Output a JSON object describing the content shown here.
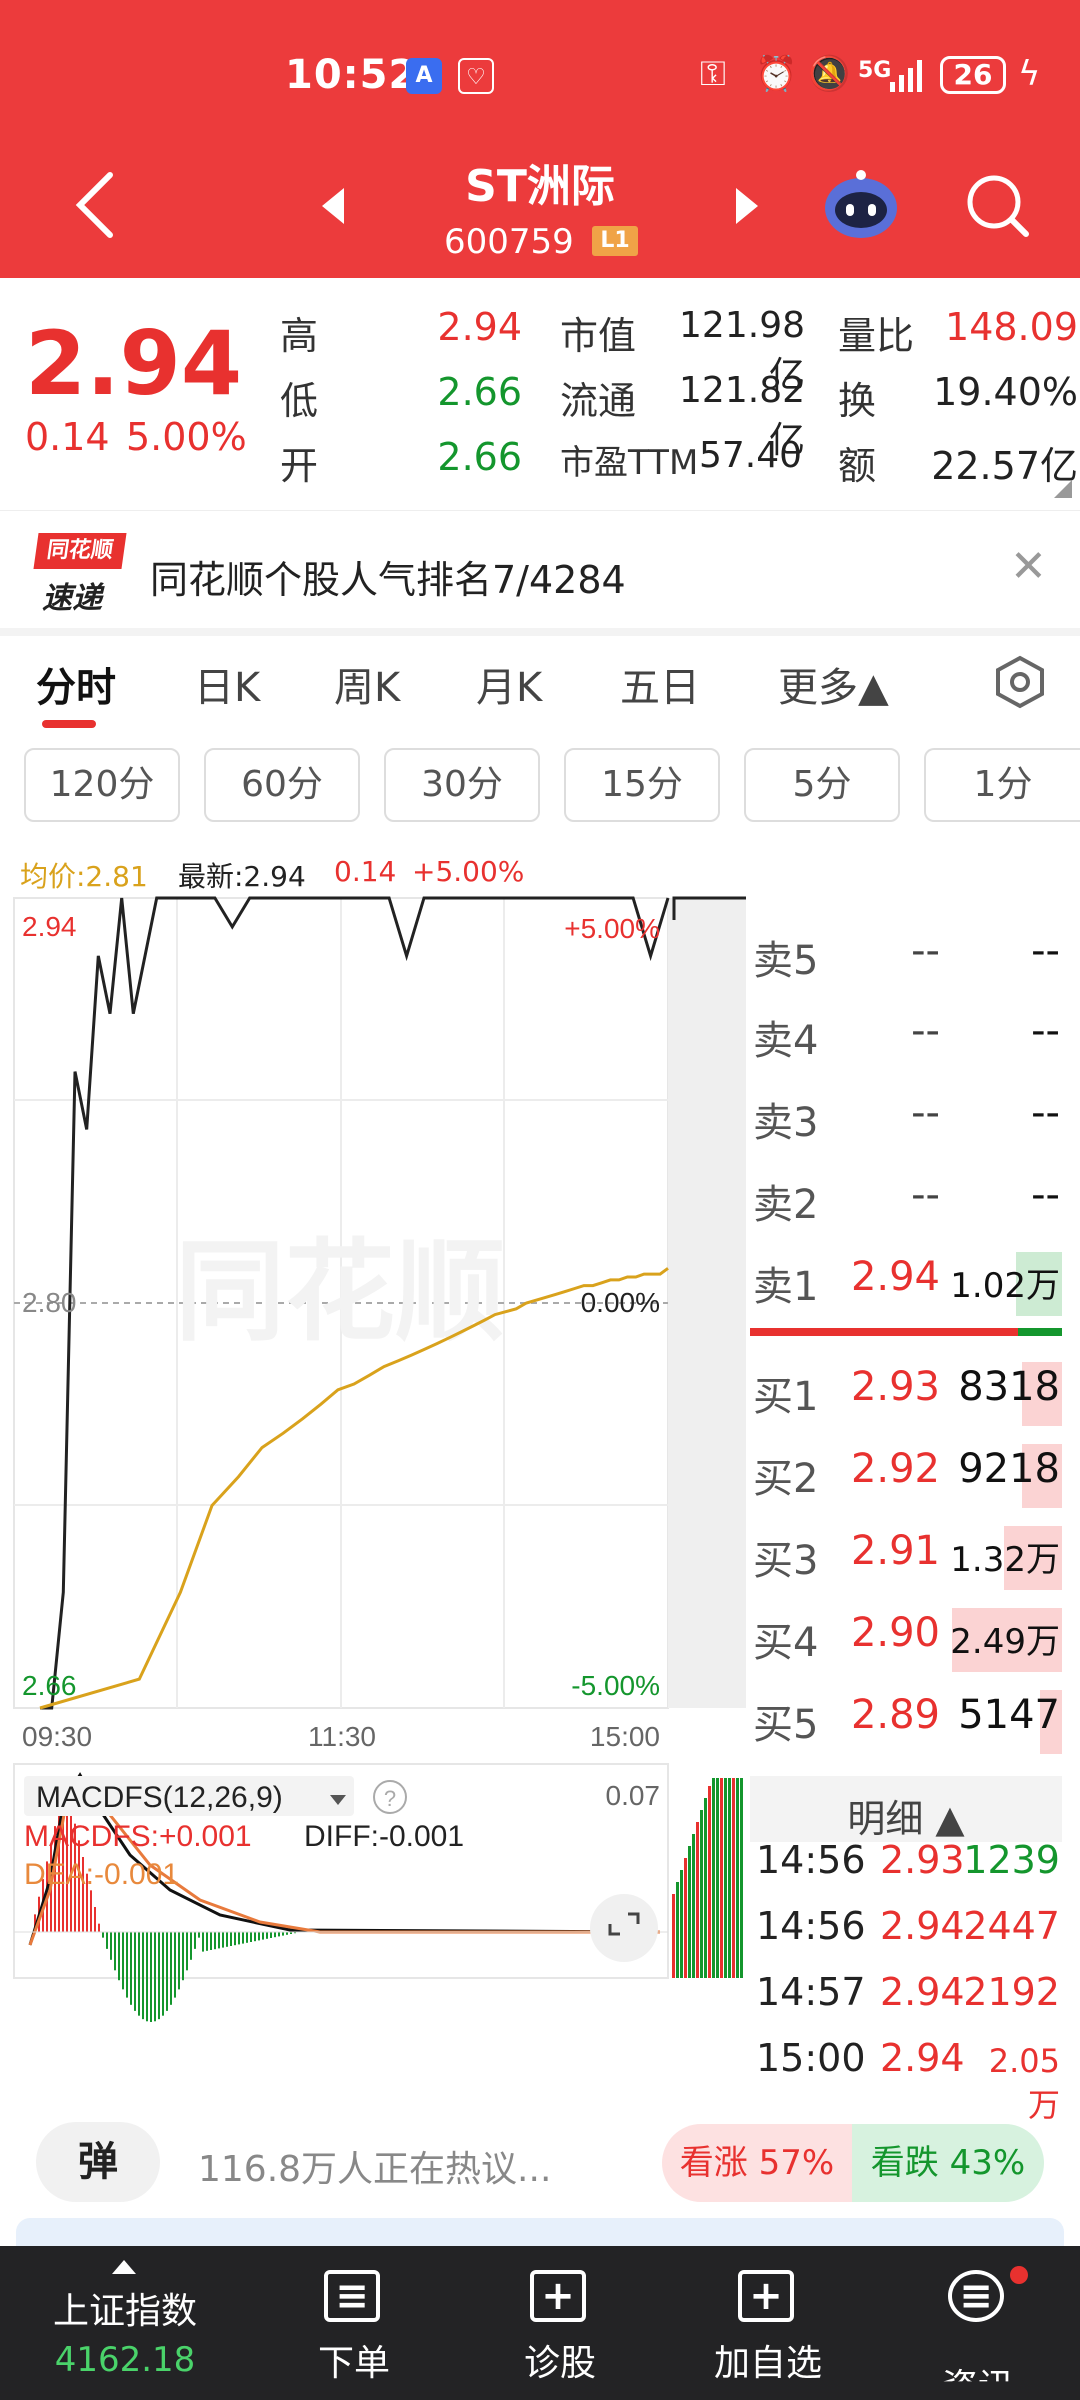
{
  "status_bar": {
    "time": "10:52",
    "network": "5G",
    "battery": "26"
  },
  "header": {
    "title": "ST洲际",
    "code": "600759",
    "level_badge": "L1"
  },
  "quote": {
    "price": "2.94",
    "change": "0.14",
    "change_pct": "5.00%",
    "stats": [
      {
        "label": "高",
        "value": "2.94"
      },
      {
        "label": "低",
        "value": "2.66"
      },
      {
        "label": "开",
        "value": "2.66"
      },
      {
        "label": "市值",
        "value": "121.98亿"
      },
      {
        "label": "流通",
        "value": "121.82亿"
      },
      {
        "label": "市盈TTM",
        "value": "57.40"
      },
      {
        "label": "量比",
        "value": "148.09"
      },
      {
        "label": "换",
        "value": "19.40%"
      },
      {
        "label": "额",
        "value": "22.57亿"
      }
    ]
  },
  "banner": {
    "logo_top": "同花顺",
    "logo_bottom": "速递",
    "text": "同花顺个股人气排名7/4284"
  },
  "tabs": [
    "分时",
    "日K",
    "周K",
    "月K",
    "五日",
    "更多▲"
  ],
  "intervals": [
    "120分",
    "60分",
    "30分",
    "15分",
    "5分",
    "1分"
  ],
  "info_line": {
    "avg": "均价:2.81",
    "latest": "最新:2.94",
    "change": "0.14",
    "change_pct": "+5.00%"
  },
  "chart_data": {
    "type": "line",
    "title": "",
    "y_left_ticks": [
      "2.94",
      "2.80",
      "2.66"
    ],
    "y_right_ticks": [
      "+5.00%",
      "0.00%",
      "-5.00%"
    ],
    "x_ticks": [
      "09:30",
      "11:30",
      "15:00"
    ],
    "ylim": [
      2.66,
      2.94
    ],
    "prev_close": 2.8,
    "watermark": "同花顺",
    "series": [
      {
        "values": [
          2.66,
          2.66,
          2.7,
          2.88,
          2.86,
          2.92,
          2.9,
          2.94,
          2.9,
          2.92,
          2.94,
          2.94,
          2.94,
          2.94,
          2.94,
          2.93,
          2.94,
          2.94,
          2.94,
          2.94,
          2.94,
          2.94,
          2.94,
          2.94,
          2.94,
          2.92,
          2.94,
          2.94,
          2.94,
          2.94,
          2.94,
          2.94,
          2.94,
          2.94,
          2.94,
          2.94,
          2.94,
          2.94,
          2.94,
          2.92,
          2.94
        ]
      },
      {
        "values": [
          2.66,
          2.67,
          2.7,
          2.73,
          2.74,
          2.75,
          2.755,
          2.76,
          2.765,
          2.77,
          2.772,
          2.775,
          2.778,
          2.78,
          2.782,
          2.784,
          2.786,
          2.788,
          2.79,
          2.792,
          2.794,
          2.796,
          2.797,
          2.798,
          2.8,
          2.801,
          2.802,
          2.803,
          2.804,
          2.805,
          2.806,
          2.806,
          2.807,
          2.808,
          2.808,
          2.809,
          2.809,
          2.81,
          2.81,
          2.81,
          2.812
        ]
      }
    ]
  },
  "macd": {
    "title": "MACDFS(12,26,9)",
    "macdfs": "MACDFS:+0.001",
    "diff": "DIFF:-0.001",
    "dea": "DEA:-0.001",
    "max_label": "0.07"
  },
  "order_book": {
    "sell": [
      {
        "label": "卖5",
        "price": "--",
        "vol": "--"
      },
      {
        "label": "卖4",
        "price": "--",
        "vol": "--"
      },
      {
        "label": "卖3",
        "price": "--",
        "vol": "--"
      },
      {
        "label": "卖2",
        "price": "--",
        "vol": "--"
      },
      {
        "label": "卖1",
        "price": "2.94",
        "vol": "1.02万"
      }
    ],
    "buy": [
      {
        "label": "买1",
        "price": "2.93",
        "vol": "8318"
      },
      {
        "label": "买2",
        "price": "2.92",
        "vol": "9218"
      },
      {
        "label": "买3",
        "price": "2.91",
        "vol": "1.32万"
      },
      {
        "label": "买4",
        "price": "2.90",
        "vol": "2.49万"
      },
      {
        "label": "买5",
        "price": "2.89",
        "vol": "5147"
      }
    ]
  },
  "detail": {
    "title": "明细 ▲",
    "rows": [
      {
        "time": "14:56",
        "price": "2.93",
        "vol": "1239"
      },
      {
        "time": "14:56",
        "price": "2.94",
        "vol": "2447"
      },
      {
        "time": "14:57",
        "price": "2.94",
        "vol": "2192"
      },
      {
        "time": "15:00",
        "price": "2.94",
        "vol": "2.05万"
      }
    ]
  },
  "discussion": {
    "button": "弹",
    "text": "116.8万人正在热议...",
    "up": "看涨 57%",
    "down": "看跌 43%",
    "up_pct": 57
  },
  "bottom_nav": [
    {
      "label": "上证指数",
      "value": "4162.18"
    },
    {
      "label": "下单"
    },
    {
      "label": "诊股"
    },
    {
      "label": "加自选"
    },
    {
      "label": "资讯"
    }
  ],
  "colors": {
    "brand": "#ec3b3c",
    "up": "#e8312f",
    "down": "#14962d",
    "avg_line": "#d9a21c"
  }
}
